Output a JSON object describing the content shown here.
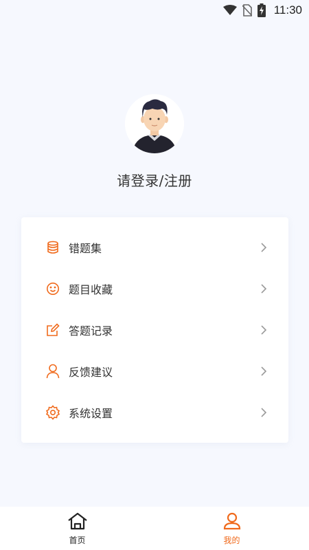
{
  "status_bar": {
    "time": "11:30"
  },
  "profile": {
    "login_label": "请登录/注册"
  },
  "menu": {
    "items": [
      {
        "label": "错题集",
        "icon": "database-icon"
      },
      {
        "label": "题目收藏",
        "icon": "smile-icon"
      },
      {
        "label": "答题记录",
        "icon": "edit-icon"
      },
      {
        "label": "反馈建议",
        "icon": "user-icon"
      },
      {
        "label": "系统设置",
        "icon": "settings-icon"
      }
    ]
  },
  "tab_bar": {
    "tabs": [
      {
        "label": "首页",
        "icon": "home-icon",
        "active": false
      },
      {
        "label": "我的",
        "icon": "user-icon",
        "active": true
      }
    ]
  },
  "colors": {
    "accent": "#f06a1c",
    "background": "#f6f8fe",
    "card": "#ffffff"
  }
}
